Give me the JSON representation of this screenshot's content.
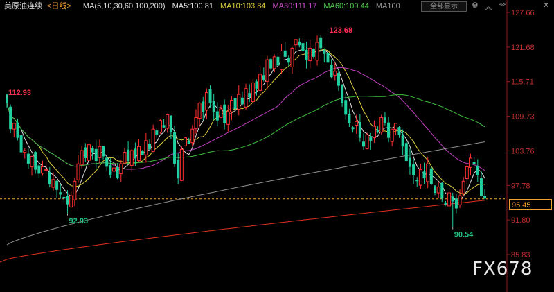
{
  "header": {
    "symbol": "美原油连续",
    "period": "<日线>",
    "ma_params": "MA(5,10,30,60,100,200)",
    "ma5": "MA5:100.81",
    "ma10": "MA10:103.84",
    "ma30": "MA30:111.17",
    "ma60": "MA60:109.44",
    "ma100": "MA100",
    "view_all": "全部显示",
    "colors": {
      "ma5": "#e0e0e0",
      "ma10": "#e0d040",
      "ma30": "#c040c0",
      "ma60": "#40c040",
      "ma100": "#909090",
      "ma200": "#e03020"
    }
  },
  "watermark": "FX678",
  "last_price": "95.45",
  "chart_data": {
    "type": "candlestick",
    "y_ticks": [
      "127.66",
      "121.68",
      "115.71",
      "109.73",
      "103.76",
      "97.78",
      "91.80",
      "85.83"
    ],
    "ylim": [
      85.83,
      127.66
    ],
    "annotations": [
      {
        "label": "112.93",
        "value": 112.93,
        "index": 0,
        "color": "#ff3050"
      },
      {
        "label": "92.93",
        "value": 92.93,
        "index": 17,
        "color": "#20c080"
      },
      {
        "label": "123.68",
        "value": 123.68,
        "index": 90,
        "color": "#ff3050"
      },
      {
        "label": "90.54",
        "value": 90.54,
        "index": 125,
        "color": "#20c080"
      }
    ],
    "last_price_line": 95.45,
    "up_color": "#ff3030",
    "down_color": "#20d0a0",
    "closes": [
      112.0,
      107.5,
      108.5,
      106.0,
      103.5,
      103.8,
      101.5,
      102.8,
      100.5,
      99.8,
      101.0,
      100.5,
      98.0,
      98.8,
      97.0,
      96.2,
      95.5,
      94.5,
      96.0,
      98.5,
      101.5,
      103.8,
      102.5,
      104.8,
      103.5,
      102.0,
      104.5,
      102.8,
      101.0,
      99.5,
      100.8,
      99.0,
      101.5,
      103.5,
      102.0,
      103.8,
      102.5,
      104.5,
      103.0,
      105.5,
      104.0,
      107.5,
      106.5,
      109.0,
      107.8,
      110.0,
      107.0,
      101.5,
      99.0,
      104.0,
      106.0,
      105.0,
      107.5,
      109.5,
      112.0,
      110.5,
      113.8,
      112.0,
      110.5,
      109.0,
      111.0,
      108.5,
      110.5,
      112.5,
      111.0,
      113.5,
      111.8,
      114.5,
      113.0,
      115.5,
      114.5,
      117.0,
      116.0,
      119.5,
      118.0,
      120.0,
      118.5,
      121.0,
      120.0,
      119.0,
      121.5,
      123.0,
      122.0,
      121.0,
      119.5,
      121.5,
      120.0,
      122.5,
      121.5,
      120.5,
      119.0,
      116.5,
      117.5,
      115.0,
      112.0,
      110.0,
      108.5,
      107.5,
      108.8,
      106.0,
      104.5,
      106.5,
      105.5,
      108.0,
      107.0,
      109.5,
      108.5,
      106.0,
      107.5,
      108.5,
      106.5,
      104.5,
      102.0,
      101.0,
      99.5,
      98.5,
      100.5,
      99.0,
      101.5,
      98.0,
      96.5,
      97.5,
      95.5,
      94.5,
      96.5,
      95.0,
      93.8,
      96.0,
      98.5,
      101.0,
      102.5,
      101.5,
      99.5,
      96.0,
      95.5
    ],
    "ma200_end": 95.2
  }
}
